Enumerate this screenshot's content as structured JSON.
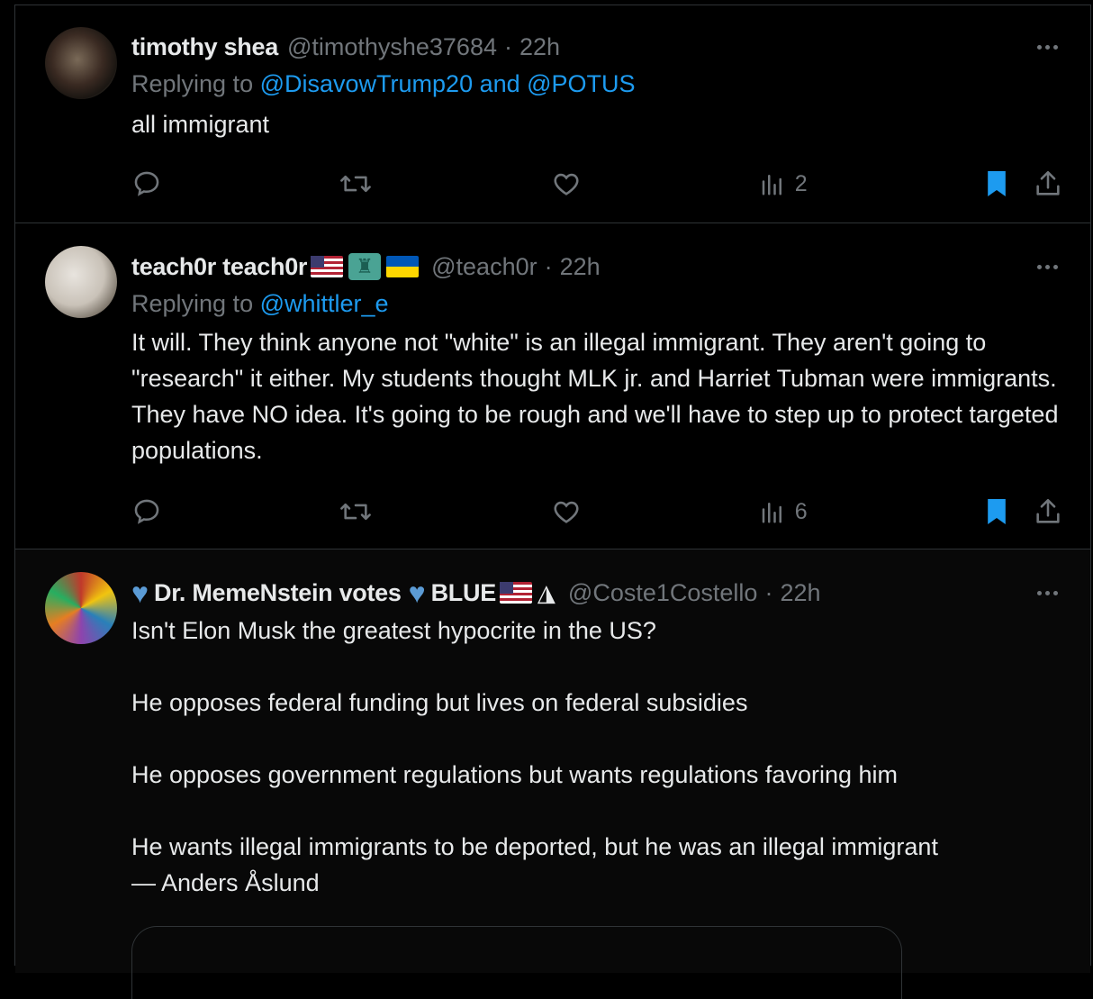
{
  "colors": {
    "accent": "#1d9bf0",
    "muted": "#71767b",
    "text": "#e7e9ea",
    "bookmark": "#1d9bf0"
  },
  "tweets": [
    {
      "name": "timothy shea",
      "handle": "@timothyshe37684",
      "time": "22h",
      "reply_prefix": "Replying to",
      "reply_targets": "@DisavowTrump20 and @POTUS",
      "text": "all immigrant",
      "views": "2",
      "bookmarked": true
    },
    {
      "name": "teach0r teach0r",
      "name_emojis": [
        "flag-us",
        "statue-of-liberty",
        "flag-ukraine"
      ],
      "handle": "@teach0r",
      "time": "22h",
      "reply_prefix": "Replying to",
      "reply_targets": "@whittler_e",
      "text": "It will. They think anyone not \"white\" is an illegal immigrant. They aren't going to \"research\" it either. My students thought MLK jr. and Harriet Tubman were immigrants. They have NO idea. It's going to be rough and we'll have to step up to protect targeted populations.",
      "views": "6",
      "bookmarked": true
    },
    {
      "name_part1": "Dr. MemeNstein votes",
      "name_part2": "BLUE",
      "name_emojis": [
        "blue-heart",
        "blue-heart",
        "flag-us",
        "eagle"
      ],
      "handle": "@Coste1Costello",
      "time": "22h",
      "paragraphs": [
        "Isn't Elon Musk the greatest hypocrite in the US?",
        "",
        "He opposes federal funding but lives on federal subsidies",
        "",
        "He opposes government regulations but wants regulations favoring him",
        "",
        "He wants illegal immigrants to be deported, but he was an illegal immigrant",
        "— Anders Åslund"
      ]
    }
  ],
  "icons": {
    "reply": "reply-icon",
    "retweet": "retweet-icon",
    "like": "heart-icon",
    "views": "views-chart-icon",
    "bookmark": "bookmark-icon",
    "share": "share-icon",
    "more": "more-dots-icon"
  }
}
